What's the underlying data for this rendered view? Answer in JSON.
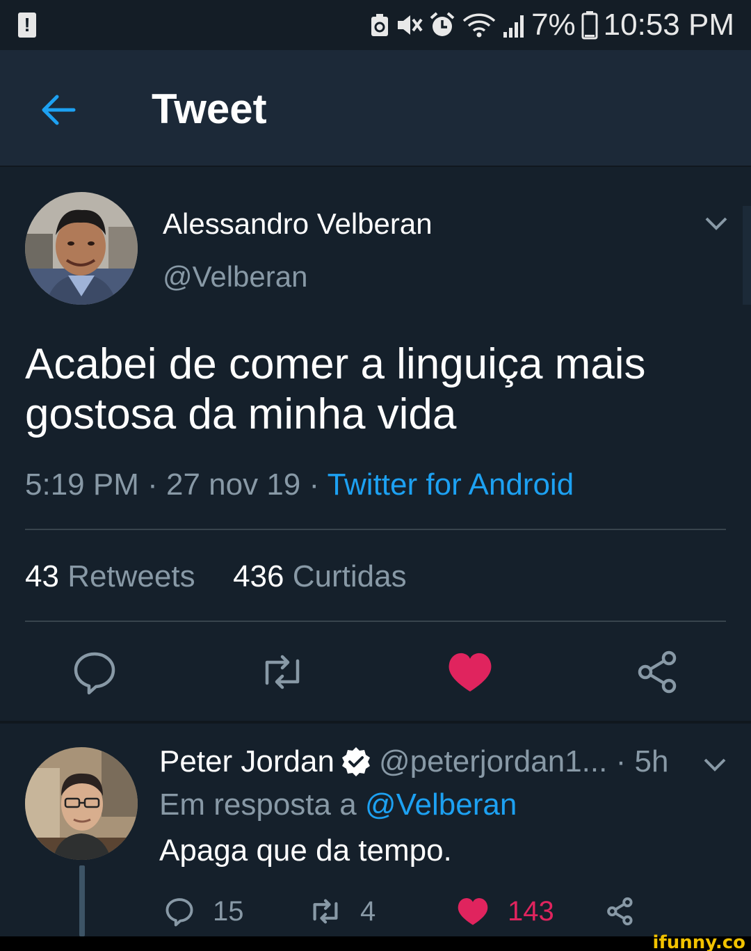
{
  "status_bar": {
    "battery_percent": "7%",
    "time": "10:53 PM",
    "icons": [
      "alert-icon",
      "battery-saver-icon",
      "mute-icon",
      "alarm-icon",
      "wifi-icon",
      "signal-icon",
      "battery-icon"
    ]
  },
  "header": {
    "title": "Tweet",
    "back_icon": "arrow-left-icon"
  },
  "tweet": {
    "author_name": "Alessandro Velberan",
    "author_handle": "@Velberan",
    "text": "Acabei de comer a linguiça mais gostosa da minha vida",
    "time": "5:19 PM",
    "date": "27 nov 19",
    "source": "Twitter for Android",
    "retweets_count": "43",
    "retweets_label": "Retweets",
    "likes_count": "436",
    "likes_label": "Curtidas",
    "liked": true
  },
  "reply": {
    "author_name": "Peter Jordan",
    "author_handle": "@peterjordan1...",
    "age": "5h",
    "verified": true,
    "in_reply_prefix": "Em resposta a",
    "in_reply_to": "@Velberan",
    "text": "Apaga que da tempo.",
    "replies": "15",
    "retweets": "4",
    "likes": "143",
    "liked": true
  },
  "watermark": "ifunny.co",
  "colors": {
    "background": "#15202b",
    "header_bg": "#1c2938",
    "accent_blue": "#1da1f2",
    "like_red": "#e0245e",
    "muted_text": "#8899a6"
  }
}
